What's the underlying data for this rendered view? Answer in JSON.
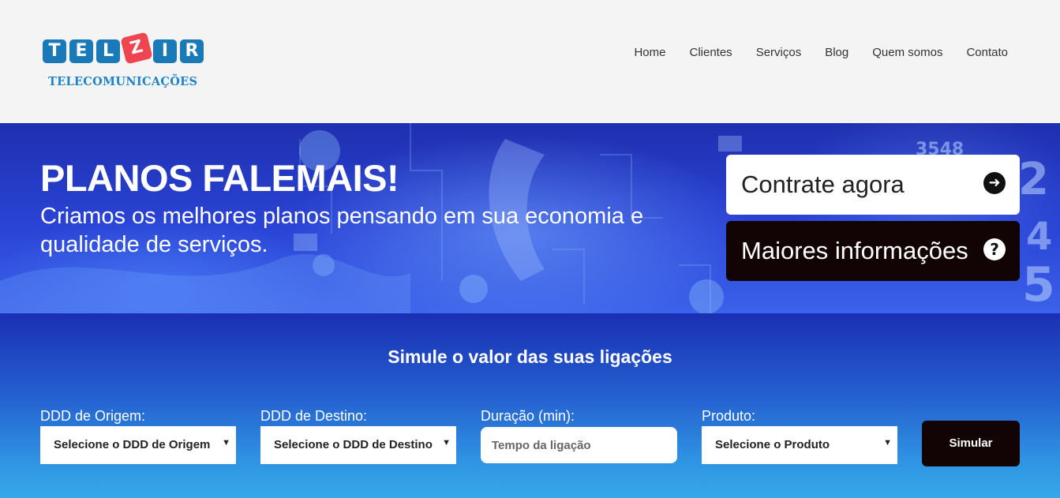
{
  "logo": {
    "letters": [
      "T",
      "E",
      "L",
      "Z",
      "I",
      "R"
    ],
    "subtitle": "TELECOMUNICAÇÕES"
  },
  "nav": {
    "items": [
      "Home",
      "Clientes",
      "Serviços",
      "Blog",
      "Quem somos",
      "Contato"
    ]
  },
  "hero": {
    "title": "PLANOS FALEMAIS!",
    "subtitle": "Criamos os melhores planos pensando em sua economia e qualidade de serviços.",
    "cta_primary": "Contrate agora",
    "cta_secondary": "Maiores informações"
  },
  "simulator": {
    "title": "Simule o valor das suas ligações",
    "origin_label": "DDD de Origem:",
    "origin_value": "Selecione o DDD de Origem",
    "dest_label": "DDD de Destino:",
    "dest_value": "Selecione o DDD de Destino",
    "duration_label": "Duração (min):",
    "duration_placeholder": "Tempo da ligação",
    "product_label": "Produto:",
    "product_value": "Selecione o Produto",
    "submit_label": "Simular"
  },
  "icons": {
    "arrow": "arrow-right-circle-icon",
    "help": "question-circle-icon",
    "caret": "caret-down-icon"
  },
  "colors": {
    "logo_blue": "#1a7ab8",
    "logo_red": "#ef4550",
    "dark_button": "#120404",
    "hero_blue": "#2a44d6"
  }
}
